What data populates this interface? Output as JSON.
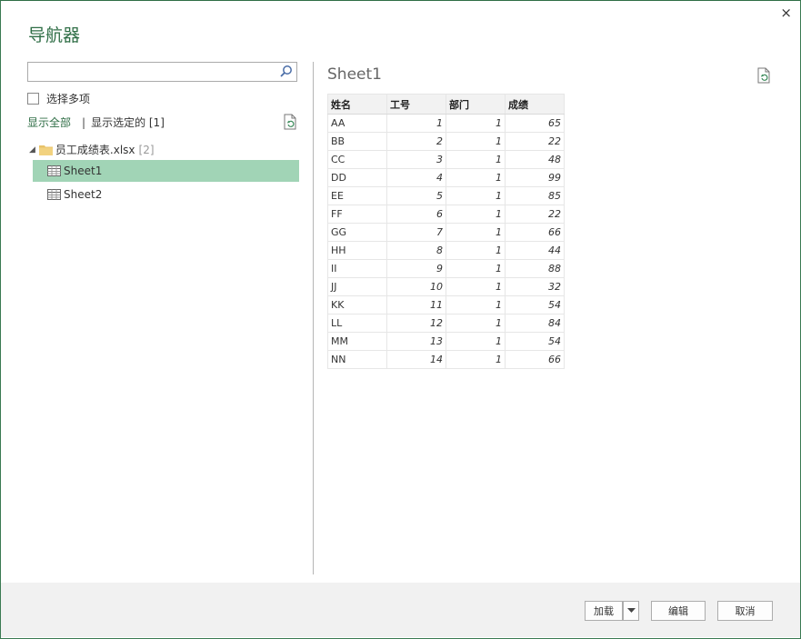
{
  "dialog": {
    "title": "导航器",
    "close_label": "×"
  },
  "left": {
    "search_placeholder": "",
    "select_multiple_label": "选择多项",
    "show_all_label": "显示全部",
    "separator": "|",
    "show_selected_label": "显示选定的 [1]",
    "tree": {
      "root_label": "员工成绩表.xlsx",
      "root_count": "[2]",
      "items": [
        {
          "label": "Sheet1",
          "selected": true
        },
        {
          "label": "Sheet2",
          "selected": false
        }
      ]
    }
  },
  "preview": {
    "title": "Sheet1",
    "columns": [
      "姓名",
      "工号",
      "部门",
      "成绩"
    ],
    "rows": [
      [
        "AA",
        "1",
        "1",
        "65"
      ],
      [
        "BB",
        "2",
        "1",
        "22"
      ],
      [
        "CC",
        "3",
        "1",
        "48"
      ],
      [
        "DD",
        "4",
        "1",
        "99"
      ],
      [
        "EE",
        "5",
        "1",
        "85"
      ],
      [
        "FF",
        "6",
        "1",
        "22"
      ],
      [
        "GG",
        "7",
        "1",
        "66"
      ],
      [
        "HH",
        "8",
        "1",
        "44"
      ],
      [
        "II",
        "9",
        "1",
        "88"
      ],
      [
        "JJ",
        "10",
        "1",
        "32"
      ],
      [
        "KK",
        "11",
        "1",
        "54"
      ],
      [
        "LL",
        "12",
        "1",
        "84"
      ],
      [
        "MM",
        "13",
        "1",
        "54"
      ],
      [
        "NN",
        "14",
        "1",
        "66"
      ]
    ]
  },
  "footer": {
    "load_label": "加载",
    "edit_label": "编辑",
    "cancel_label": "取消"
  },
  "colors": {
    "accent": "#2f6e46",
    "selection": "#a1d4b6",
    "footer_bg": "#f1f1f1"
  }
}
